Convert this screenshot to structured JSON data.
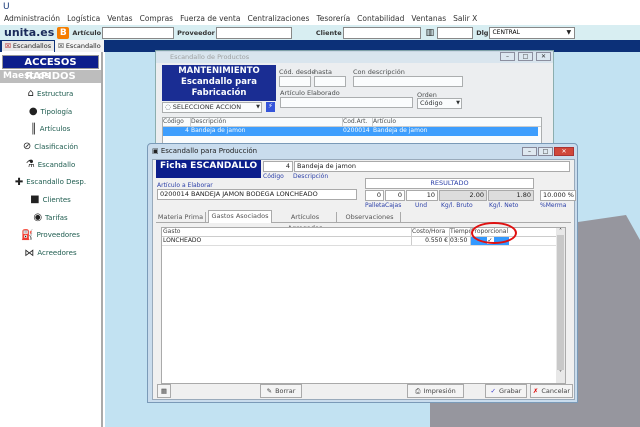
{
  "menu": [
    "Administración",
    "Logística",
    "Ventas",
    "Compras",
    "Fuerza de venta",
    "Centralizaciones",
    "Tesorería",
    "Contabilidad",
    "Ventanas",
    "Salir X"
  ],
  "toolbar": {
    "logo": "unita.es",
    "articulo_label": "Artículo",
    "proveedor_label": "Proveedor",
    "cliente_label": "Cliente",
    "dlg_label": "Dlg",
    "dlg_value": "CENTRAL"
  },
  "tabs": [
    "Escandallos",
    "Escandallo"
  ],
  "sidebar": {
    "title": "ACCESOS RAPIDOS",
    "section": "Maestros",
    "items": [
      {
        "label": "Estructura",
        "icon": "house-icon"
      },
      {
        "label": "Tipología",
        "icon": "speech-bubble-icon"
      },
      {
        "label": "Artículos",
        "icon": "barcode-icon"
      },
      {
        "label": "Clasificación",
        "icon": "compass-icon"
      },
      {
        "label": "Escandallo",
        "icon": "flask-icon"
      },
      {
        "label": "Escandallo Desp.",
        "icon": "puzzle-icon"
      },
      {
        "label": "Clientes",
        "icon": "briefcase-icon"
      },
      {
        "label": "Tarifas",
        "icon": "tag-icon"
      },
      {
        "label": "Proveedores",
        "icon": "fuel-pump-icon"
      },
      {
        "label": "Acreedores",
        "icon": "bow-tie-icon"
      }
    ]
  },
  "back_window": {
    "title": "Escandallo de Productos",
    "banner": [
      "MANTENIMIENTO",
      "Escandallo para",
      "Fabricación"
    ],
    "cod_desde": "Cód. desde",
    "hasta": "hasta",
    "con_descripcion": "Con descripción",
    "articulo_elaborado": "Artículo Elaborado",
    "orden_label": "Orden",
    "orden_value": "Código",
    "accion": "SELECCIONE ACCION",
    "columns": [
      "Código",
      "Descripción",
      "Cod.Art.",
      "Artículo"
    ],
    "rows": [
      [
        "4",
        "Bandeja de jamon",
        "0200014",
        "Bandeja de jamon"
      ]
    ]
  },
  "front_window": {
    "title": "Escandallo para Producción",
    "banner": "Ficha ESCANDALLO",
    "codigo": "4",
    "descripcion": "Bandeja de jamon",
    "codigo_label": "Código",
    "descripcion_label": "Descripción",
    "articulo_label": "Artículo a Elaborar",
    "articulo": "0200014 BANDEJA JAMON BODEGA LONCHEADO",
    "resultado_label": "RESULTADO",
    "resultado": [
      {
        "label": "Palleta",
        "value": "0"
      },
      {
        "label": "Cajas",
        "value": "0"
      },
      {
        "label": "Und",
        "value": "10"
      },
      {
        "label": "Kg/l. Bruto",
        "value": "2.00"
      },
      {
        "label": "Kg/l. Neto",
        "value": "1.80"
      }
    ],
    "merma_label": "%Merma",
    "merma": "10.000 %",
    "tabs": [
      "Materia Prima",
      "Gastos Asociados",
      "Artículos Agregados",
      "Observaciones"
    ],
    "active_tab": 1,
    "columns": [
      "Gasto",
      "Costo/Hora",
      "Tiempo",
      "Proporcional"
    ],
    "rows": [
      {
        "gasto": "LONCHEADO",
        "costo": "0.550 €",
        "tiempo": "03:50",
        "proporcional": true
      }
    ],
    "buttons": {
      "borrar": "Borrar",
      "impresion": "Impresión",
      "grabar": "Grabar",
      "cancelar": "Cancelar"
    }
  },
  "colors": {
    "navy": "#0c1e8c",
    "selection": "#3399ff",
    "highlight_circle": "#e01010"
  }
}
